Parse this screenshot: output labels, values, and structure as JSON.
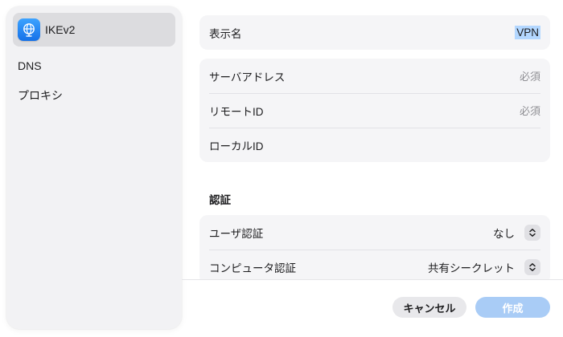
{
  "sidebar": {
    "items": [
      {
        "label": "IKEv2",
        "icon": "globe-icon",
        "selected": true
      },
      {
        "label": "DNS",
        "selected": false
      },
      {
        "label": "プロキシ",
        "selected": false
      }
    ]
  },
  "form": {
    "display_name": {
      "label": "表示名",
      "value": "VPN"
    },
    "server": {
      "server_address": {
        "label": "サーバアドレス",
        "placeholder": "必須"
      },
      "remote_id": {
        "label": "リモートID",
        "placeholder": "必須"
      },
      "local_id": {
        "label": "ローカルID",
        "placeholder": ""
      }
    },
    "auth": {
      "section_title": "認証",
      "user_auth": {
        "label": "ユーザ認証",
        "value": "なし"
      },
      "computer_auth": {
        "label": "コンピュータ認証",
        "value": "共有シークレット"
      }
    }
  },
  "footer": {
    "cancel_label": "キャンセル",
    "create_label": "作成"
  },
  "colors": {
    "accent": "#1571e8",
    "selection_highlight": "#b3d7ff",
    "create_disabled": "#a9ccf6"
  }
}
